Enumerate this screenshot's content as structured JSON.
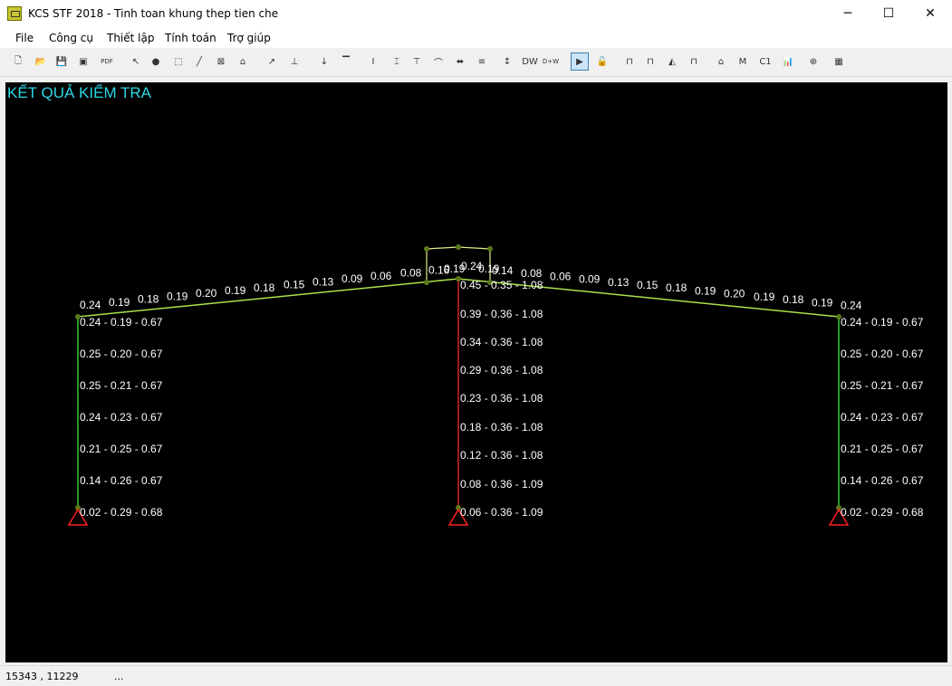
{
  "window": {
    "title": "KCS STF 2018 - Tinh toan khung thep tien che",
    "minimize": "─",
    "maximize": "☐",
    "close": "✕"
  },
  "menu": [
    "File",
    "Công cụ",
    "Thiết lập",
    "Tính toán",
    "Trợ giúp"
  ],
  "toolbar": [
    {
      "icon": "new-file-icon",
      "glyph": "🗋"
    },
    {
      "icon": "open-folder-icon",
      "glyph": "📂"
    },
    {
      "icon": "save-icon",
      "glyph": "💾"
    },
    {
      "icon": "save-all-icon",
      "glyph": "▣"
    },
    {
      "icon": "pdf-icon",
      "glyph": "PDF"
    },
    {
      "icon": "select-pointer-icon",
      "glyph": "↖"
    },
    {
      "icon": "node-icon",
      "glyph": "●"
    },
    {
      "icon": "rect-node-icon",
      "glyph": "⬚"
    },
    {
      "icon": "line-icon",
      "glyph": "╱"
    },
    {
      "icon": "diagonal-node-icon",
      "glyph": "⊠"
    },
    {
      "icon": "frame-add-icon",
      "glyph": "⌂"
    },
    {
      "icon": "load-icon",
      "glyph": "↗"
    },
    {
      "icon": "support-icon",
      "glyph": "⊥"
    },
    {
      "icon": "point-load-icon",
      "glyph": "↓"
    },
    {
      "icon": "dist-load-icon",
      "glyph": "▔"
    },
    {
      "icon": "i-section-icon",
      "glyph": "I"
    },
    {
      "icon": "tapered-section-icon",
      "glyph": "⌶"
    },
    {
      "icon": "beam-section-icon",
      "glyph": "⊤"
    },
    {
      "icon": "haunch-icon",
      "glyph": "⌒"
    },
    {
      "icon": "brace-icon",
      "glyph": "⬌"
    },
    {
      "icon": "purlin-icon",
      "glyph": "≡"
    },
    {
      "icon": "dimension-icon",
      "glyph": "↕"
    },
    {
      "icon": "dl-w-combo-icon",
      "glyph": "DW"
    },
    {
      "icon": "dl-plus-w-combo-icon",
      "glyph": "D+W"
    },
    {
      "icon": "run-icon",
      "glyph": "▶"
    },
    {
      "icon": "unlock-icon",
      "glyph": "🔓"
    },
    {
      "icon": "frame-view-icon",
      "glyph": "⊓"
    },
    {
      "icon": "frame-hinge-view-icon",
      "glyph": "⊓"
    },
    {
      "icon": "moment-diagram-icon",
      "glyph": "◭"
    },
    {
      "icon": "shear-diagram-icon",
      "glyph": "⊓"
    },
    {
      "icon": "deflection-icon",
      "glyph": "⌂"
    },
    {
      "icon": "check-frame-icon",
      "glyph": "M"
    },
    {
      "icon": "c1b1-icon",
      "glyph": "C1"
    },
    {
      "icon": "chart-icon",
      "glyph": "📊"
    },
    {
      "icon": "connection-icon",
      "glyph": "⊕"
    },
    {
      "icon": "table-icon",
      "glyph": "▦"
    }
  ],
  "canvas": {
    "title": "KẾT QUẢ KIỂM TRA",
    "left_column_labels": [
      "0.24 - 0.19 - 0.67",
      "0.25 - 0.20 - 0.67",
      "0.25 - 0.21 - 0.67",
      "0.24 - 0.23 - 0.67",
      "0.21 - 0.25 - 0.67",
      "0.14 - 0.26 - 0.67",
      "0.02 - 0.29 - 0.68"
    ],
    "center_column_labels": [
      "0.45 - 0.35 - 1.08",
      "0.39 - 0.36 - 1.08",
      "0.34 - 0.36 - 1.08",
      "0.29 - 0.36 - 1.08",
      "0.23 - 0.36 - 1.08",
      "0.18 - 0.36 - 1.08",
      "0.12 - 0.36 - 1.08",
      "0.08 - 0.36 - 1.09",
      "0.06 - 0.36 - 1.09"
    ],
    "right_column_labels": [
      "0.24 - 0.19 - 0.67",
      "0.25 - 0.20 - 0.67",
      "0.25 - 0.21 - 0.67",
      "0.24 - 0.23 - 0.67",
      "0.21 - 0.25 - 0.67",
      "0.14 - 0.26 - 0.67",
      "0.02 - 0.29 - 0.68"
    ],
    "left_rafter_labels": [
      "0.24",
      "0.19",
      "0.18",
      "0.19",
      "0.20",
      "0.19",
      "0.18",
      "0.15",
      "0.13",
      "0.09",
      "0.06",
      "0.08",
      "0.16"
    ],
    "right_rafter_labels": [
      "0.14",
      "0.08",
      "0.06",
      "0.09",
      "0.13",
      "0.15",
      "0.18",
      "0.19",
      "0.20",
      "0.19",
      "0.18",
      "0.19",
      "0.24"
    ],
    "top_labels": [
      "0.19",
      "0.24",
      "0.19"
    ],
    "colors": {
      "title": "#2fd6e6",
      "column_ok": "#33cc33",
      "column_center": "#d42020",
      "rafter": "#a8e34a",
      "monitor": "#e6e68a",
      "support": "#ff2020",
      "node": "#5a7a1a"
    }
  },
  "status": {
    "coords": "15343 , 11229",
    "extra": "..."
  }
}
